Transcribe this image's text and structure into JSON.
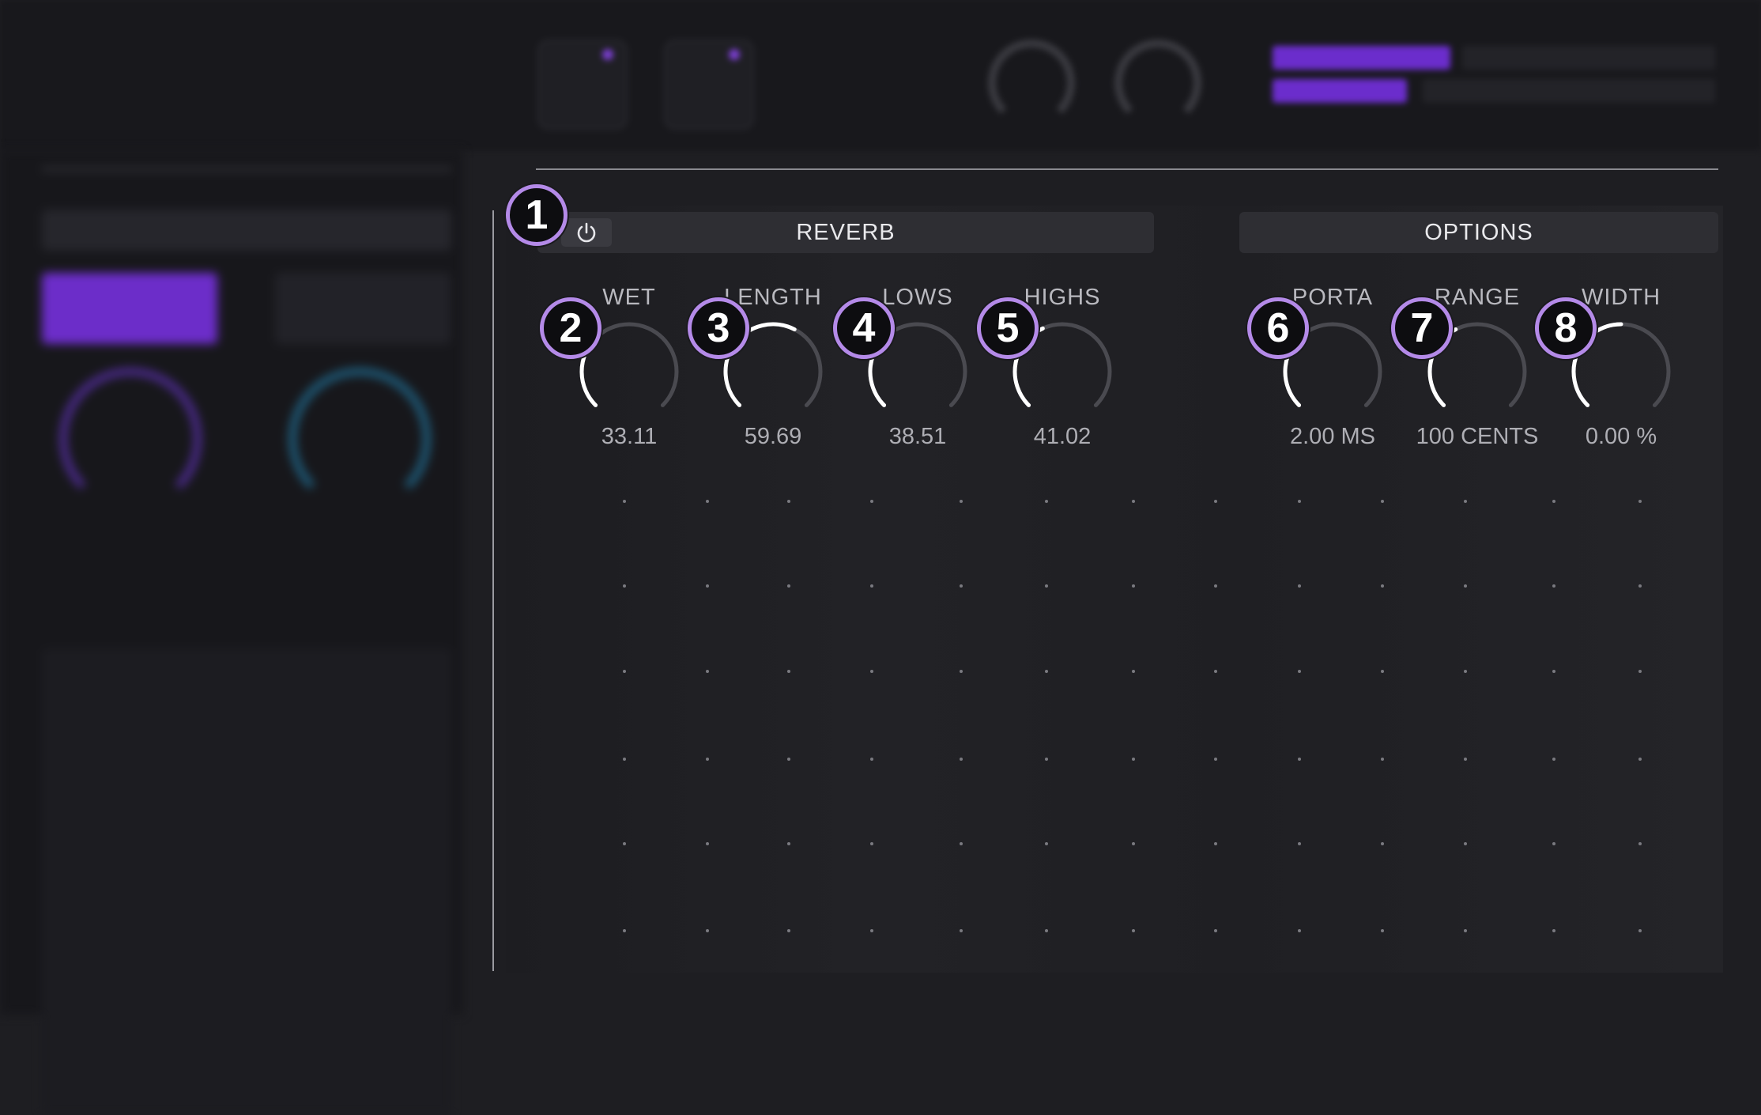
{
  "reverb": {
    "title": "REVERB",
    "power_icon": "power-icon",
    "knobs": [
      {
        "id": "wet",
        "label": "WET",
        "value": "33.11",
        "level": 0.33
      },
      {
        "id": "length",
        "label": "LENGTH",
        "value": "59.69",
        "level": 0.6
      },
      {
        "id": "lows",
        "label": "LOWS",
        "value": "38.51",
        "level": 0.385
      },
      {
        "id": "highs",
        "label": "HIGHS",
        "value": "41.02",
        "level": 0.41
      }
    ]
  },
  "options": {
    "title": "OPTIONS",
    "knobs": [
      {
        "id": "porta",
        "label": "PORTA",
        "value": "2.00 MS",
        "level": 0.38
      },
      {
        "id": "range",
        "label": "RANGE",
        "value": "100 CENTS",
        "level": 0.4
      },
      {
        "id": "width",
        "label": "WIDTH",
        "value": "0.00 %",
        "level": 0.5
      }
    ]
  },
  "badges": [
    "1",
    "2",
    "3",
    "4",
    "5",
    "6",
    "7",
    "8"
  ],
  "colors": {
    "accent": "#7b3fd1",
    "badge_ring": "#b48ae8",
    "knob_active": "#ffffff",
    "knob_track": "#4a4a50"
  }
}
